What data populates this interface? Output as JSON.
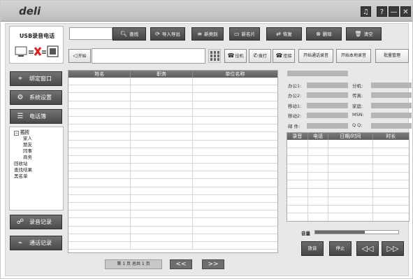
{
  "app": {
    "logo": "deli",
    "brand_title": "USB录音电话"
  },
  "titlebar": {
    "music_icon": "♫",
    "help_label": "?",
    "min_label": "—",
    "close_label": "✕"
  },
  "toolbar_top": {
    "search_value": "",
    "search_label": "查找",
    "import_export_label": "导入导出",
    "new_category_label": "新类别",
    "new_card_label": "新名片",
    "restore_label": "恢复",
    "delete_label": "删除",
    "clear_label": "清空"
  },
  "toolbar_dial": {
    "dial_label": "开始",
    "dial_value": "",
    "hangup_label": "挂机",
    "call_label": "拨打",
    "reject_label": "拒接",
    "start_call_rec_label": "开始通话录音",
    "start_local_rec_label": "开始本地录音",
    "batch_label": "批量管理"
  },
  "sidebar": {
    "bind_window": "绑定窗口",
    "settings": "系统设置",
    "phonebook": "电话簿",
    "recordings": "录音记录",
    "call_log": "通话记录"
  },
  "tree": {
    "root": "名片",
    "children": [
      "家人",
      "朋友",
      "同事",
      "商务"
    ],
    "others": [
      "回收站",
      "查找结果",
      "黑名单"
    ]
  },
  "contacts_table": {
    "columns": [
      "姓名",
      "职务",
      "单位名称"
    ],
    "rows": 22
  },
  "pager": {
    "info": "第 1 页 总共 1 页",
    "prev": "<<",
    "next": ">>"
  },
  "details": {
    "office1": "办公1:",
    "office2": "办公2:",
    "mobile1": "移动1:",
    "mobile2": "移动2:",
    "email": "邮  件:",
    "ext": "分机:",
    "fax": "传真:",
    "home": "家庭:",
    "msn": "MSN:",
    "qq": "Q  Q:"
  },
  "records_table": {
    "columns": [
      "录音",
      "电话",
      "日期/时间",
      "时长"
    ],
    "rows": 10
  },
  "player": {
    "volume_label": "音量",
    "volume_level": 0.6,
    "play_label": "放音",
    "stop_label": "停止",
    "prev_label": "◁◁",
    "next_label": "▷▷"
  },
  "colors": {
    "titlebar": "#c4c4c4",
    "button_dark": "#4a4a4a",
    "panel": "#e8e8e8",
    "grid_line": "#d6d6d6",
    "detail_field": "#b6b6b6",
    "brand_red": "#e02020"
  }
}
